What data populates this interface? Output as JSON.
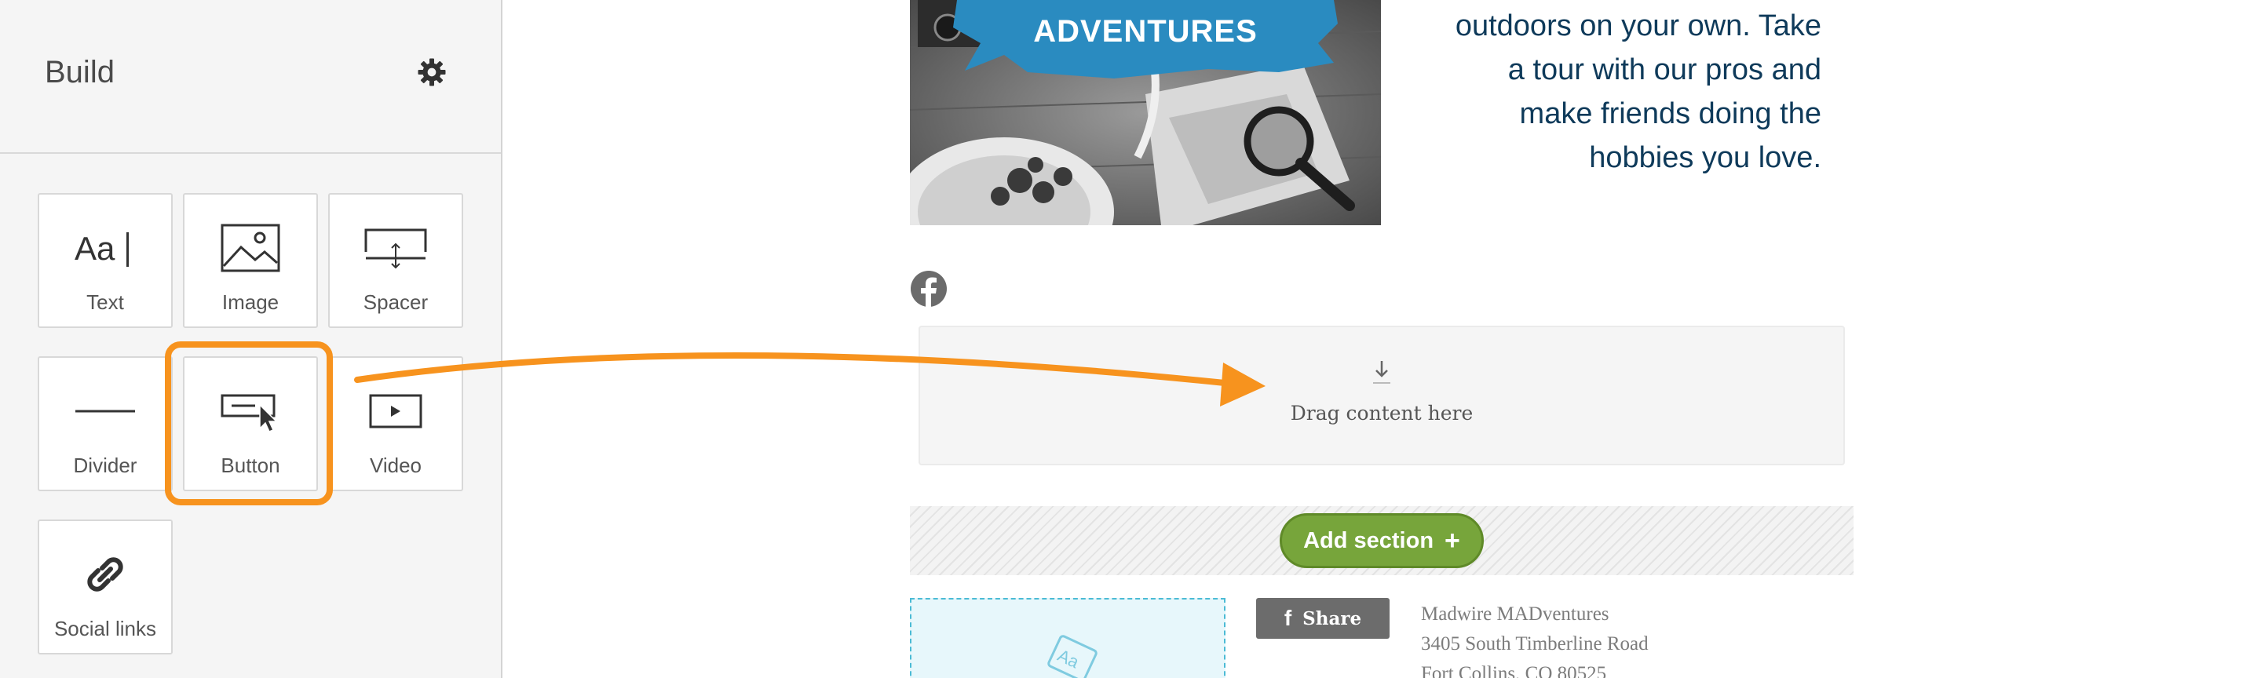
{
  "sidebar": {
    "title": "Build",
    "tiles": [
      {
        "label": "Text",
        "icon": "text-icon"
      },
      {
        "label": "Image",
        "icon": "image-icon"
      },
      {
        "label": "Spacer",
        "icon": "spacer-icon"
      },
      {
        "label": "Divider",
        "icon": "divider-icon"
      },
      {
        "label": "Button",
        "icon": "button-icon"
      },
      {
        "label": "Video",
        "icon": "video-icon"
      },
      {
        "label": "Social links",
        "icon": "link-icon"
      }
    ]
  },
  "hero": {
    "banner": "ADVENTURES",
    "lines": [
      "outdoors on your own. Take",
      "a tour with our pros and",
      "make friends doing the",
      "hobbies you love."
    ]
  },
  "dropzone": {
    "text": "Drag content here"
  },
  "add_section": {
    "label": "Add section",
    "plus": "+"
  },
  "share": {
    "label": "Share",
    "icon": "f"
  },
  "address": {
    "lines": [
      "Madwire MADventures",
      "3405 South Timberline Road",
      "Fort Collins, CO 80525"
    ]
  },
  "text_placeholder": {
    "glyph": "Aa"
  },
  "colors": {
    "accent": "#f7931e",
    "add_button": "#77a53b",
    "banner": "#2a8bc0",
    "hero_text": "#0e3a5a"
  }
}
